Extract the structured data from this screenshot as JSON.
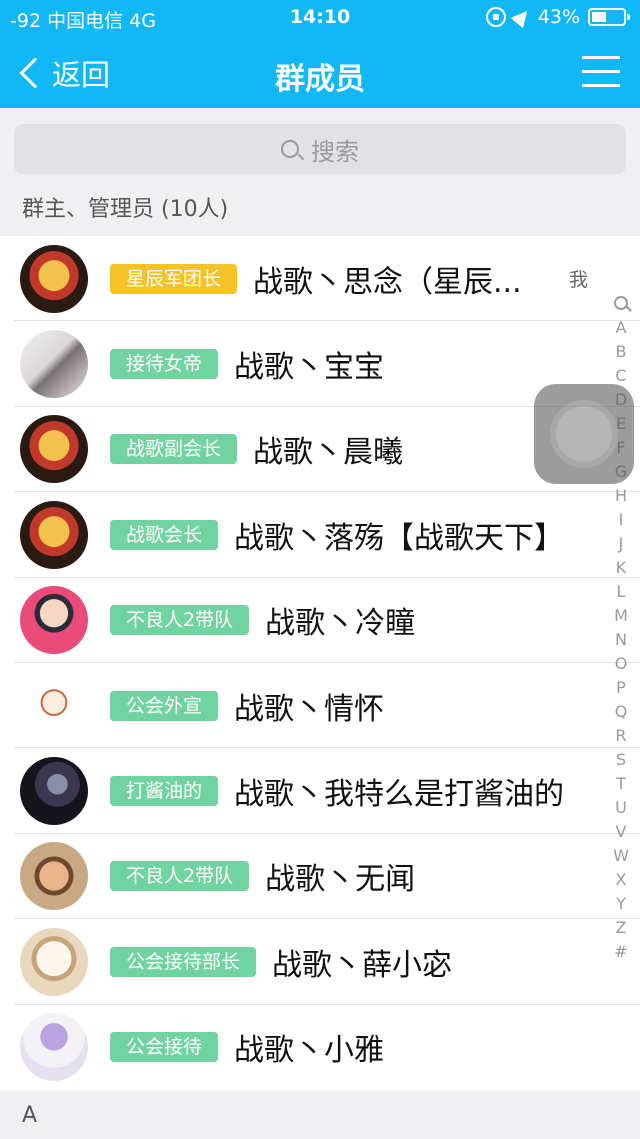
{
  "status_bar": {
    "signal_carrier": "-92 中国电信  4G",
    "time": "14:10",
    "battery": "43%",
    "icons": [
      "orientation-lock-icon",
      "location-arrow-icon",
      "battery-icon"
    ]
  },
  "nav": {
    "back_label": "返回",
    "title": "群成员",
    "menu_icon": "menu-icon"
  },
  "search": {
    "placeholder": "搜索"
  },
  "section_admins": {
    "title": "群主、管理员 (10人)"
  },
  "members": [
    {
      "badge": "星辰军团长",
      "badge_color": "#f5c228",
      "name": "战歌丶思念（星辰...",
      "me": "我"
    },
    {
      "badge": "接待女帝",
      "badge_color": "#72d3a2",
      "name": "战歌丶宝宝"
    },
    {
      "badge": "战歌副会长",
      "badge_color": "#72d3a2",
      "name": "战歌丶晨曦"
    },
    {
      "badge": "战歌会长",
      "badge_color": "#72d3a2",
      "name": "战歌丶落殇【战歌天下】"
    },
    {
      "badge": "不良人2带队",
      "badge_color": "#72d3a2",
      "name": "战歌丶冷瞳"
    },
    {
      "badge": "公会外宣",
      "badge_color": "#72d3a2",
      "name": "战歌丶情怀"
    },
    {
      "badge": "打酱油的",
      "badge_color": "#72d3a2",
      "name": "战歌丶我特么是打酱油的"
    },
    {
      "badge": "不良人2带队",
      "badge_color": "#72d3a2",
      "name": "战歌丶无闻"
    },
    {
      "badge": "公会接待部长",
      "badge_color": "#72d3a2",
      "name": "战歌丶薛小宓"
    },
    {
      "badge": "公会接待",
      "badge_color": "#72d3a2",
      "name": "战歌丶小雅"
    }
  ],
  "section_a": {
    "title": "A"
  },
  "index_bar": [
    "A",
    "B",
    "C",
    "D",
    "E",
    "F",
    "G",
    "H",
    "I",
    "J",
    "K",
    "L",
    "M",
    "N",
    "O",
    "P",
    "Q",
    "R",
    "S",
    "T",
    "U",
    "V",
    "W",
    "X",
    "Y",
    "Z",
    "#"
  ],
  "colors": {
    "accent": "#12b7f5",
    "badge_gold": "#f5c228",
    "badge_green": "#72d3a2"
  }
}
